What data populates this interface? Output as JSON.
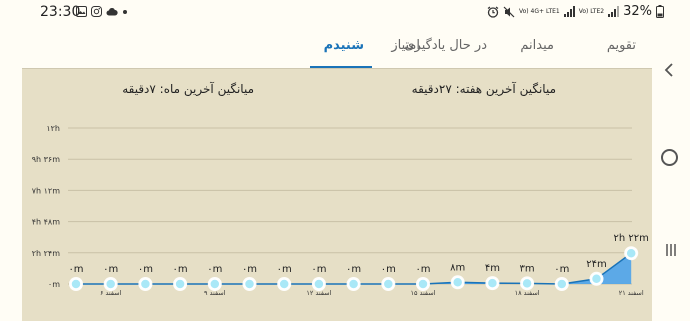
{
  "status_bar": {
    "time": "23:30",
    "left_icons": [
      "image-icon",
      "instagram-icon",
      "cloud-icon",
      "dot-icon"
    ],
    "right_icons": [
      "alarm-icon",
      "mute-icon",
      "volte1-icon",
      "signal-icon",
      "volte2-icon",
      "signal-icon"
    ],
    "volte1_text": "Vo) 4G+ LTE1",
    "volte2_text": "Vo) LTE2",
    "battery": "32%"
  },
  "tabs": [
    {
      "label": "تقویم",
      "active": false
    },
    {
      "label": "میدانم",
      "active": false
    },
    {
      "label": "در حال یادگیری",
      "active": false
    },
    {
      "label": "امتیاز",
      "active": false
    },
    {
      "label": "شنیدم",
      "active": true
    }
  ],
  "stats": {
    "week": "میانگین آخرین هفته: ۲۷دقیقه",
    "month": "میانگین آخرین ماه: ۷دقیقه"
  },
  "accent_color": "#1a73b8",
  "chart_data": {
    "type": "area",
    "ylim": [
      0,
      720
    ],
    "yticks": [
      {
        "value": 0,
        "label": "۰m"
      },
      {
        "value": 144,
        "label": "۲h ۲۴m"
      },
      {
        "value": 288,
        "label": "۴h ۴۸m"
      },
      {
        "value": 432,
        "label": "۷h ۱۲m"
      },
      {
        "value": 576,
        "label": "۹h ۳۶m"
      },
      {
        "value": 720,
        "label": "۱۲h"
      }
    ],
    "x_labels": [
      {
        "index": 1,
        "label": "۶ اسفند"
      },
      {
        "index": 4,
        "label": "۹ اسفند"
      },
      {
        "index": 7,
        "label": "۱۲ اسفند"
      },
      {
        "index": 10,
        "label": "۱۵ اسفند"
      },
      {
        "index": 13,
        "label": "۱۸ اسفند"
      },
      {
        "index": 16,
        "label": "۲۱ اسفند"
      }
    ],
    "points": [
      {
        "value": 0,
        "label": "۰m"
      },
      {
        "value": 0,
        "label": "۰m"
      },
      {
        "value": 0,
        "label": "۰m"
      },
      {
        "value": 0,
        "label": "۰m"
      },
      {
        "value": 0,
        "label": "۰m"
      },
      {
        "value": 0,
        "label": "۰m"
      },
      {
        "value": 0,
        "label": "۰m"
      },
      {
        "value": 0,
        "label": "۰m"
      },
      {
        "value": 0,
        "label": "۰m"
      },
      {
        "value": 0,
        "label": "۰m"
      },
      {
        "value": 0,
        "label": "۰m"
      },
      {
        "value": 8,
        "label": "۸m"
      },
      {
        "value": 4,
        "label": "۴m"
      },
      {
        "value": 3,
        "label": "۳m"
      },
      {
        "value": 0,
        "label": "۰m"
      },
      {
        "value": 24,
        "label": "۲۴m"
      },
      {
        "value": 142,
        "label": "۲h ۲۲m"
      }
    ],
    "line_color": "#1a73b8",
    "fill_color": "#4da3ea",
    "point_color": "#a9e8f7",
    "grid": true
  }
}
